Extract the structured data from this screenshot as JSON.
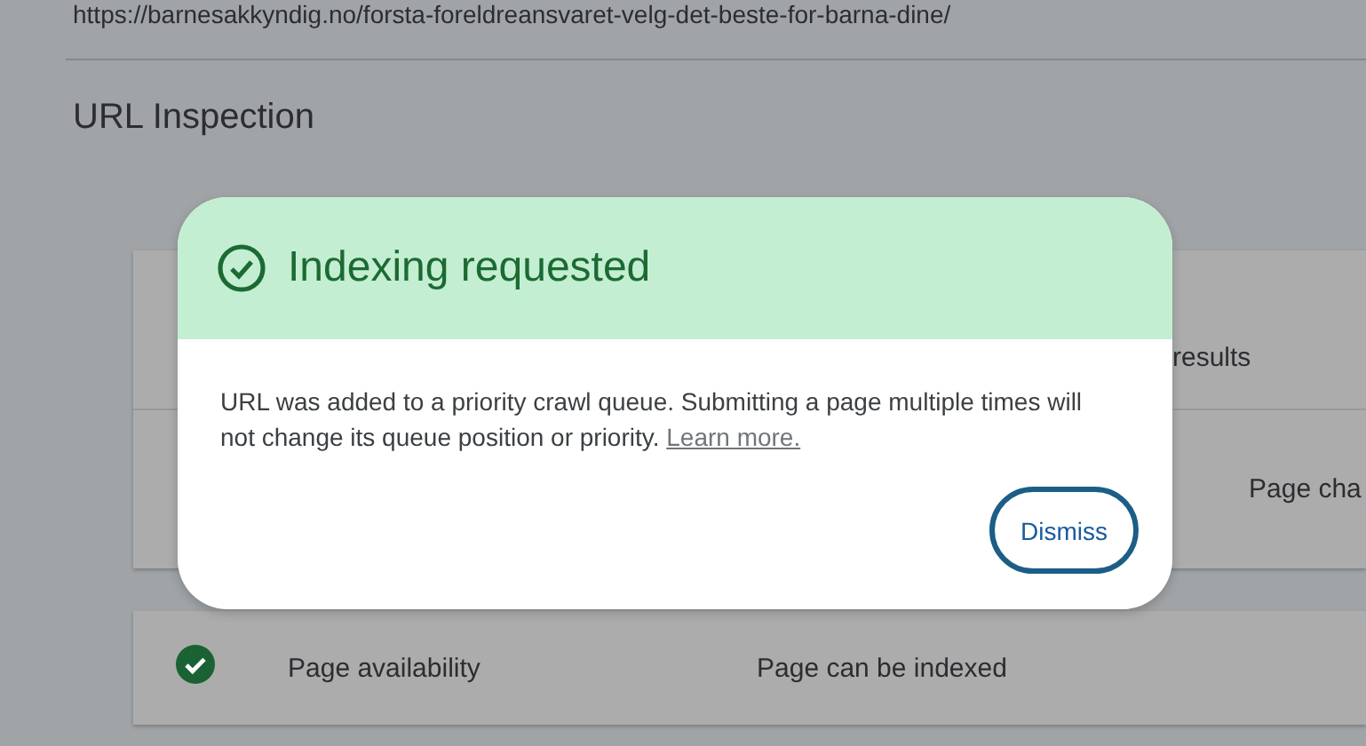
{
  "page": {
    "url": "https://barnesakkyndig.no/forsta-foreldreansvaret-velg-det-beste-for-barna-dine/",
    "title": "URL Inspection"
  },
  "cards": [
    {
      "rows": [
        {
          "value": "results"
        },
        {
          "value": "Page cha"
        }
      ]
    },
    {
      "rows": [
        {
          "status_icon": true,
          "label": "Page availability",
          "value": "Page can be indexed"
        }
      ]
    }
  ],
  "dialog": {
    "title": "Indexing requested",
    "message": "URL was added to a priority crawl queue. Submitting a page multiple times will not change its queue position or priority.",
    "link": "Learn more.",
    "button": "Dismiss"
  }
}
